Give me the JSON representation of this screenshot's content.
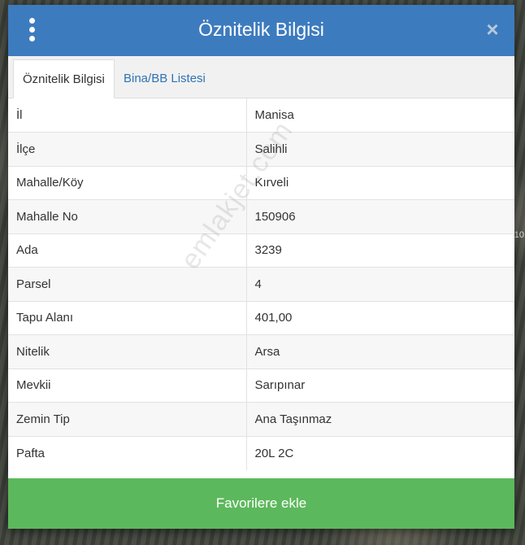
{
  "dialog": {
    "title": "Öznitelik Bilgisi",
    "close_label": "×"
  },
  "tabs": [
    {
      "label": "Öznitelik Bilgisi",
      "active": true
    },
    {
      "label": "Bina/BB Listesi",
      "active": false
    }
  ],
  "attributes": [
    {
      "key": "İl",
      "value": "Manisa"
    },
    {
      "key": "İlçe",
      "value": "Salihli"
    },
    {
      "key": "Mahalle/Köy",
      "value": "Kırveli"
    },
    {
      "key": "Mahalle No",
      "value": "150906"
    },
    {
      "key": "Ada",
      "value": "3239"
    },
    {
      "key": "Parsel",
      "value": "4"
    },
    {
      "key": "Tapu Alanı",
      "value": "401,00"
    },
    {
      "key": "Nitelik",
      "value": "Arsa"
    },
    {
      "key": "Mevkii",
      "value": "Sarıpınar"
    },
    {
      "key": "Zemin Tip",
      "value": "Ana Taşınmaz"
    },
    {
      "key": "Pafta",
      "value": "20L 2C"
    }
  ],
  "footer": {
    "favorite_label": "Favorilere ekle"
  },
  "watermark": "emlakjet.com",
  "map": {
    "edge_label": "10"
  },
  "colors": {
    "header": "#3d7bbf",
    "button": "#5cb85c",
    "tab_link": "#2f74b5"
  },
  "icons": {
    "menu": "kebab-menu-icon",
    "close": "close-icon"
  }
}
